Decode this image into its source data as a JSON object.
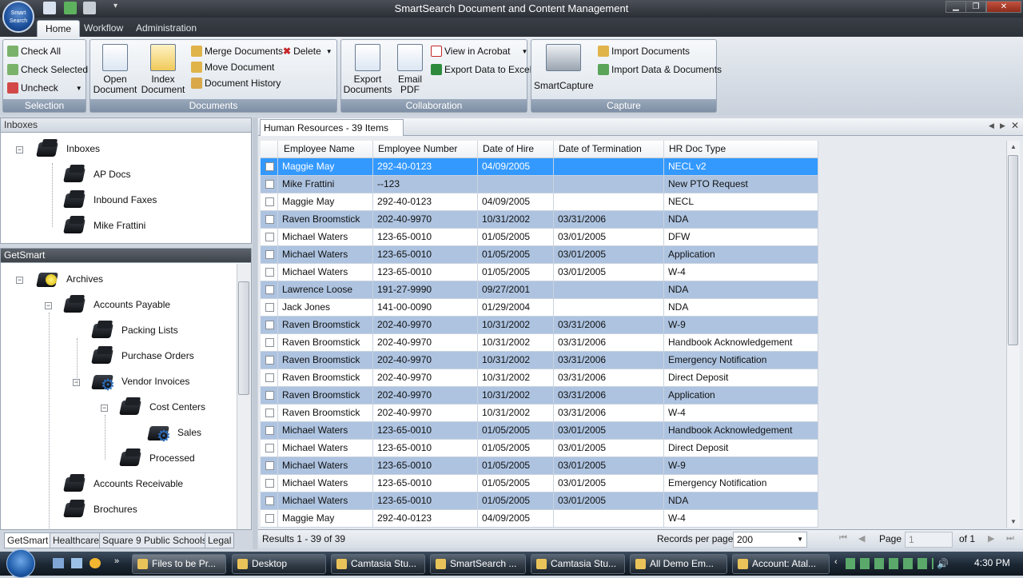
{
  "window": {
    "title": "SmartSearch Document and Content Management",
    "orb_label": "Smart Search"
  },
  "ribbon": {
    "tabs": [
      {
        "label": "Home"
      },
      {
        "label": "Workflow"
      },
      {
        "label": "Administration"
      }
    ],
    "selection": {
      "label": "Selection",
      "check_all": "Check All",
      "check_selected": "Check Selected",
      "uncheck": "Uncheck"
    },
    "documents": {
      "label": "Documents",
      "open": [
        "Open",
        "Document"
      ],
      "index": [
        "Index",
        "Document"
      ],
      "merge": "Merge Documents",
      "delete": "Delete",
      "move": "Move Document",
      "history": "Document History"
    },
    "collaboration": {
      "label": "Collaboration",
      "export": [
        "Export",
        "Documents"
      ],
      "email": [
        "Email",
        "PDF"
      ],
      "view_acrobat": "View in Acrobat",
      "export_excel": "Export Data to Excel"
    },
    "capture": {
      "label": "Capture",
      "smartcapture": "SmartCapture",
      "import_docs": "Import Documents",
      "import_data": "Import Data & Documents"
    }
  },
  "inboxes": {
    "header": "Inboxes",
    "root": "Inboxes",
    "items": [
      "AP Docs",
      "Inbound Faxes",
      "Mike Frattini"
    ]
  },
  "getsmart": {
    "header": "GetSmart",
    "nodes": [
      "Archives",
      "Accounts Payable",
      "Packing Lists",
      "Purchase Orders",
      "Vendor Invoices",
      "Cost Centers",
      "Sales",
      "Processed",
      "Accounts Receivable",
      "Brochures"
    ],
    "tabs": [
      "GetSmart",
      "Healthcare",
      "Square 9 Public Schools",
      "Legal"
    ]
  },
  "results": {
    "tab_title": "Human Resources - 39 Items",
    "columns": [
      "Employee Name",
      "Employee Number",
      "Date of Hire",
      "Date of Termination",
      "HR Doc Type"
    ],
    "rows": [
      [
        "Maggie May",
        "292-40-0123",
        "04/09/2005",
        "",
        "NECL v2"
      ],
      [
        "Mike Frattini",
        "--123",
        "",
        "",
        "New PTO Request"
      ],
      [
        "Maggie May",
        "292-40-0123",
        "04/09/2005",
        "",
        "NECL"
      ],
      [
        "Raven Broomstick",
        "202-40-9970",
        "10/31/2002",
        "03/31/2006",
        "NDA"
      ],
      [
        "Michael Waters",
        "123-65-0010",
        "01/05/2005",
        "03/01/2005",
        "DFW"
      ],
      [
        "Michael Waters",
        "123-65-0010",
        "01/05/2005",
        "03/01/2005",
        "Application"
      ],
      [
        "Michael Waters",
        "123-65-0010",
        "01/05/2005",
        "03/01/2005",
        "W-4"
      ],
      [
        "Lawrence Loose",
        "191-27-9990",
        "09/27/2001",
        "",
        "NDA"
      ],
      [
        "Jack Jones",
        "141-00-0090",
        "01/29/2004",
        "",
        "NDA"
      ],
      [
        "Raven Broomstick",
        "202-40-9970",
        "10/31/2002",
        "03/31/2006",
        "W-9"
      ],
      [
        "Raven Broomstick",
        "202-40-9970",
        "10/31/2002",
        "03/31/2006",
        "Handbook Acknowledgement"
      ],
      [
        "Raven Broomstick",
        "202-40-9970",
        "10/31/2002",
        "03/31/2006",
        "Emergency Notification"
      ],
      [
        "Raven Broomstick",
        "202-40-9970",
        "10/31/2002",
        "03/31/2006",
        "Direct Deposit"
      ],
      [
        "Raven Broomstick",
        "202-40-9970",
        "10/31/2002",
        "03/31/2006",
        "Application"
      ],
      [
        "Raven Broomstick",
        "202-40-9970",
        "10/31/2002",
        "03/31/2006",
        "W-4"
      ],
      [
        "Michael Waters",
        "123-65-0010",
        "01/05/2005",
        "03/01/2005",
        "Handbook Acknowledgement"
      ],
      [
        "Michael Waters",
        "123-65-0010",
        "01/05/2005",
        "03/01/2005",
        "Direct Deposit"
      ],
      [
        "Michael Waters",
        "123-65-0010",
        "01/05/2005",
        "03/01/2005",
        "W-9"
      ],
      [
        "Michael Waters",
        "123-65-0010",
        "01/05/2005",
        "03/01/2005",
        "Emergency Notification"
      ],
      [
        "Michael Waters",
        "123-65-0010",
        "01/05/2005",
        "03/01/2005",
        "NDA"
      ],
      [
        "Maggie May",
        "292-40-0123",
        "04/09/2005",
        "",
        "W-4"
      ]
    ],
    "row_styles": [
      "sel",
      "alt",
      "plain",
      "alt",
      "plain",
      "alt",
      "plain",
      "alt",
      "plain",
      "alt",
      "plain",
      "alt",
      "plain",
      "alt",
      "plain",
      "alt",
      "plain",
      "alt",
      "plain",
      "alt",
      "plain"
    ],
    "footer": {
      "summary": "Results 1 - 39 of 39",
      "records_label": "Records per page",
      "records_value": "200",
      "page_label": "Page",
      "page_value": "1",
      "of_pages": "of 1"
    }
  },
  "taskbar": {
    "items": [
      "Files to be Pr...",
      "Desktop",
      "Camtasia Stu...",
      "SmartSearch ...",
      "Camtasia Stu...",
      "All Demo Em...",
      "Account: Atal..."
    ],
    "clock": "4:30 PM"
  },
  "colors": {
    "selected_row": "#3399ff",
    "alt_row": "#adc3e0",
    "ribbon_label": "#7e8fa5"
  }
}
